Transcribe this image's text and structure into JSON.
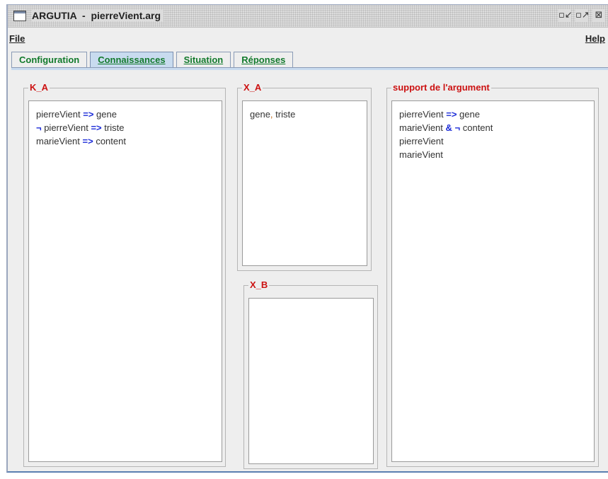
{
  "window": {
    "title": "ARGUTIA  -  pierreVient.arg",
    "controls": {
      "minimize": "▫↙",
      "maximize": "▫↗",
      "close": "⊠"
    }
  },
  "menu": {
    "file": "File",
    "help": "Help"
  },
  "tabs": [
    {
      "label": "Configuration",
      "selected": false
    },
    {
      "label": "Connaissances",
      "selected": true
    },
    {
      "label": "Situation",
      "selected": false
    },
    {
      "label": "Réponses",
      "selected": false
    }
  ],
  "panels": {
    "k_a": {
      "title": "K_A",
      "lines": [
        {
          "parts": [
            [
              "pierreVient ",
              "text"
            ],
            [
              "=>",
              "op"
            ],
            [
              " gene",
              "text"
            ]
          ]
        },
        {
          "parts": [
            [
              "¬",
              "op"
            ],
            [
              " pierreVient ",
              "text"
            ],
            [
              "=>",
              "op"
            ],
            [
              " triste",
              "text"
            ]
          ]
        },
        {
          "parts": [
            [
              "marieVient ",
              "text"
            ],
            [
              "=>",
              "op"
            ],
            [
              " content",
              "text"
            ]
          ]
        }
      ]
    },
    "x_a": {
      "title": "X_A",
      "lines": [
        {
          "parts": [
            [
              "gene",
              "text"
            ],
            [
              ",",
              "comma"
            ],
            [
              " triste",
              "text"
            ]
          ]
        }
      ]
    },
    "x_b": {
      "title": "X_B",
      "lines": []
    },
    "support": {
      "title": "support de l'argument",
      "lines": [
        {
          "parts": [
            [
              "pierreVient ",
              "text"
            ],
            [
              "=>",
              "op"
            ],
            [
              " gene",
              "text"
            ]
          ]
        },
        {
          "parts": [
            [
              "marieVient ",
              "text"
            ],
            [
              "&",
              "op"
            ],
            [
              " ",
              "text"
            ],
            [
              "¬",
              "op"
            ],
            [
              " content",
              "text"
            ]
          ]
        },
        {
          "parts": [
            [
              "pierreVient",
              "text"
            ]
          ]
        },
        {
          "parts": [
            [
              "marieVient",
              "text"
            ]
          ]
        }
      ]
    }
  },
  "colors": {
    "tab_text": "#11792b",
    "group_title": "#cc1111",
    "operator": "#1b2bd8",
    "comma": "#c46a15"
  }
}
